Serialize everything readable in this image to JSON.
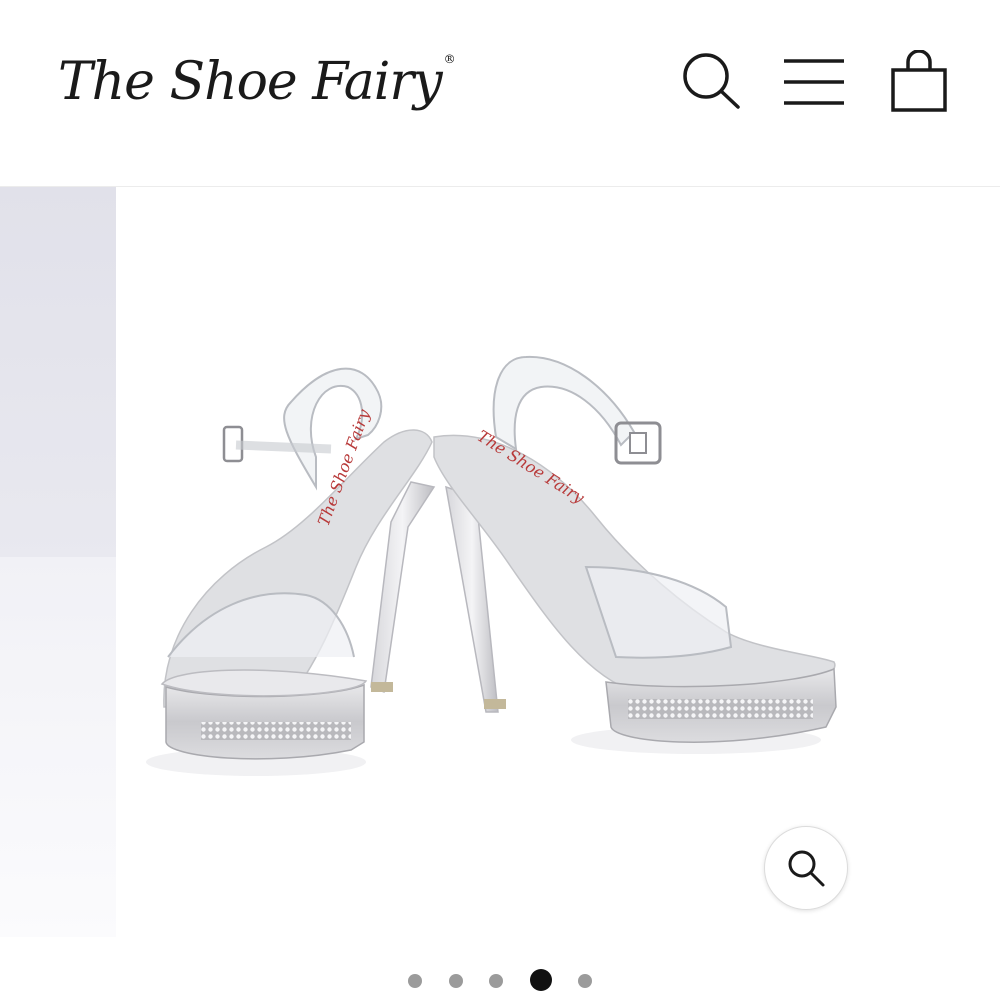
{
  "header": {
    "logo_text": "The Shoe Fairy",
    "logo_mark": "®",
    "icons": [
      "search-icon",
      "menu-icon",
      "shopping-bag-icon"
    ]
  },
  "gallery": {
    "slide_count": 5,
    "active_slide": 4,
    "zoom_icon": "magnifier-icon",
    "insole_print": "The Shoe Fairy"
  },
  "colors": {
    "text": "#1a1a1a",
    "dot_inactive": "#9b9b9b",
    "dot_active": "#111111",
    "insole_print": "#b83a3a"
  }
}
